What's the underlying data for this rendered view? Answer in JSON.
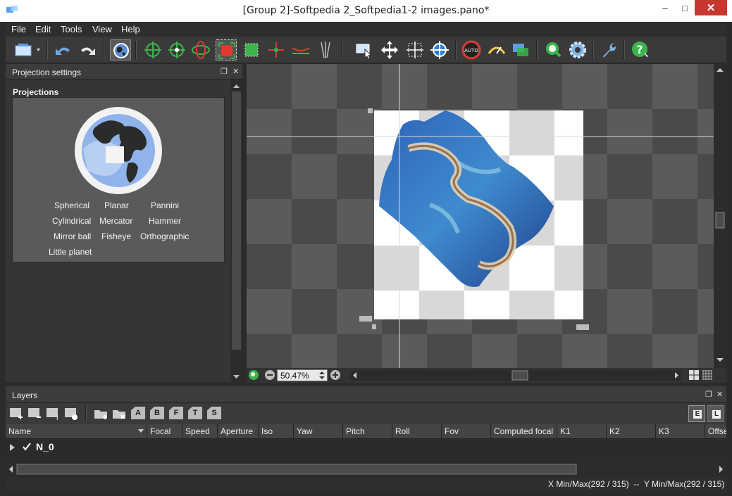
{
  "window": {
    "title": "[Group 2]-Softpedia 2_Softpedia1-2 images.pano*",
    "minimize_glyph": "–",
    "maximize_glyph": "□",
    "close_glyph": "✕"
  },
  "menu": {
    "items": [
      {
        "label": "File"
      },
      {
        "label": "Edit"
      },
      {
        "label": "Tools"
      },
      {
        "label": "View"
      },
      {
        "label": "Help"
      }
    ]
  },
  "toolbar": {
    "icons": [
      "export-icon",
      "undo-icon",
      "redo-icon",
      "globe-view-icon",
      "crosshair-add-icon",
      "crosshair-move-icon",
      "orbit-icon",
      "crop-fit-icon",
      "mask-icon",
      "anchor-icon",
      "horizon-icon",
      "mirror-icon",
      "select-icon",
      "move-icon",
      "spread-icon",
      "target-icon",
      "auto-color-icon",
      "exposure-icon",
      "blend-icon",
      "search-icon",
      "settings-icon",
      "wrench-icon",
      "help-icon"
    ]
  },
  "projection_panel": {
    "title": "Projection settings",
    "float_glyph": "❐",
    "close_glyph": "✕",
    "section_label": "Projections",
    "items": [
      {
        "label": "Spherical"
      },
      {
        "label": "Planar"
      },
      {
        "label": "Pannini"
      },
      {
        "label": "Cylindrical"
      },
      {
        "label": "Mercator"
      },
      {
        "label": "Hammer"
      },
      {
        "label": "Mirror ball"
      },
      {
        "label": "Fisheye"
      },
      {
        "label": "Orthographic"
      },
      {
        "label": "Little planet"
      }
    ]
  },
  "viewport": {
    "zoom_value": "50.47%"
  },
  "layers_panel": {
    "title": "Layers",
    "float_glyph": "❐",
    "close_glyph": "✕",
    "tool_letters": [
      "A",
      "B",
      "F",
      "T",
      "S"
    ],
    "view_letters": [
      "E",
      "L"
    ],
    "columns": [
      {
        "label": "Name"
      },
      {
        "label": "Focal"
      },
      {
        "label": "Speed"
      },
      {
        "label": "Aperture"
      },
      {
        "label": "Iso"
      },
      {
        "label": "Yaw"
      },
      {
        "label": "Pitch"
      },
      {
        "label": "Roll"
      },
      {
        "label": "Fov"
      },
      {
        "label": "Computed focal"
      },
      {
        "label": "K1"
      },
      {
        "label": "K2"
      },
      {
        "label": "K3"
      },
      {
        "label": "Offse"
      }
    ],
    "rows": [
      {
        "name": "N_0",
        "checked": true
      }
    ]
  },
  "status": {
    "text": "X Min/Max(292 / 315)  --  Y Min/Max(292 / 315)"
  },
  "colors": {
    "accent_green": "#3bb54a",
    "accent_blue": "#2d7fd6",
    "close_red": "#c7372f"
  }
}
